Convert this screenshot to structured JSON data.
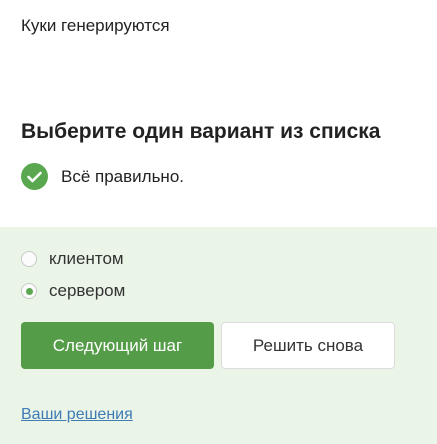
{
  "question": {
    "text": "Куки генерируются"
  },
  "task": {
    "title": "Выберите один вариант из списка"
  },
  "result": {
    "icon": "check-circle-icon",
    "text": "Всё правильно."
  },
  "options": [
    {
      "label": "клиентом",
      "selected": false
    },
    {
      "label": "сервером",
      "selected": true
    }
  ],
  "buttons": {
    "next_label": "Следующий шаг",
    "retry_label": "Решить снова"
  },
  "links": {
    "solutions_label": "Ваши решения"
  },
  "colors": {
    "accent": "#59a84f",
    "panel": "#eaf5e8",
    "link": "#3f7bb5"
  }
}
